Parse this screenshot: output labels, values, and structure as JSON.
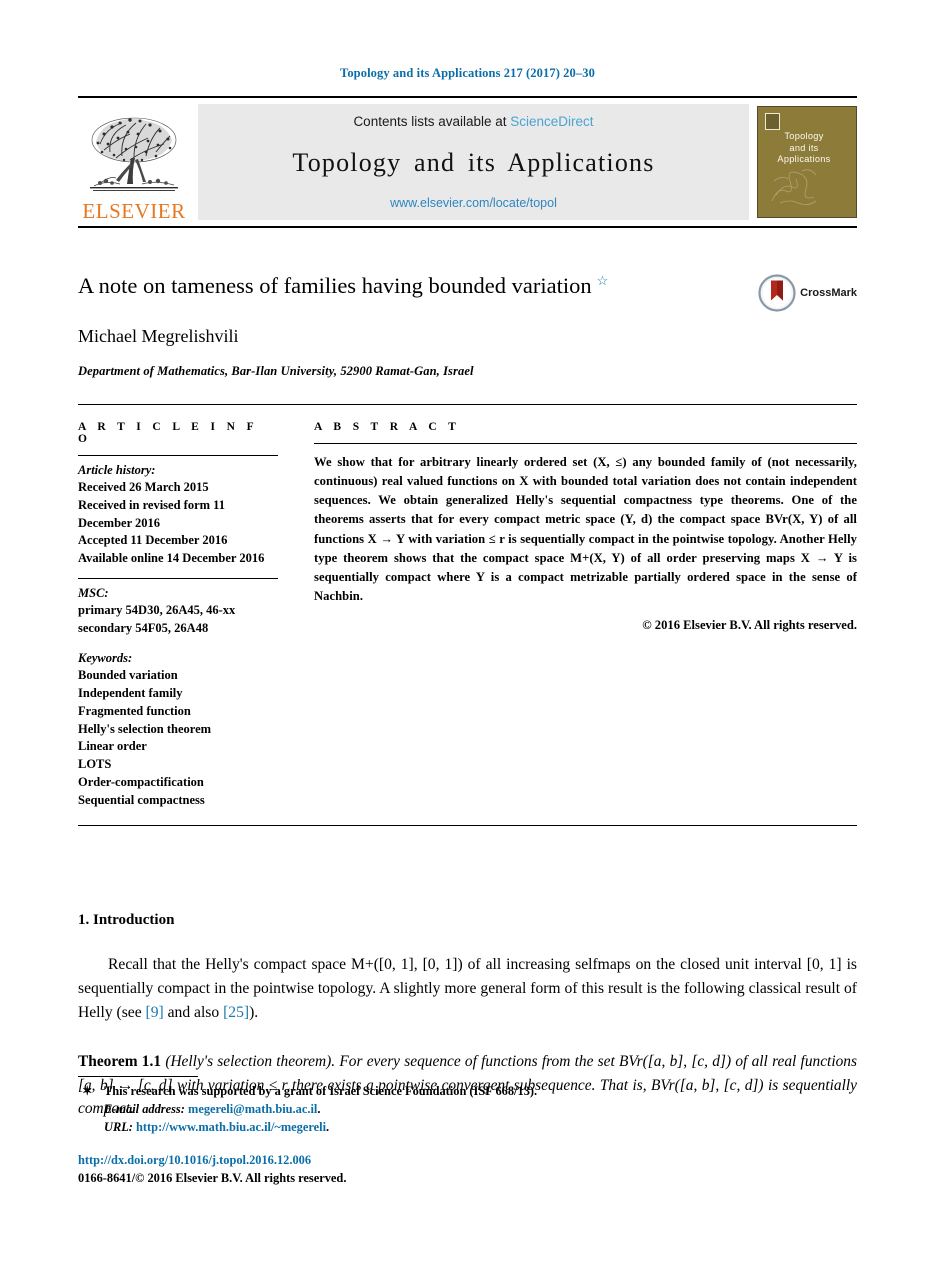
{
  "running_head": "Topology and its Applications 217 (2017) 20–30",
  "masthead": {
    "contents_prefix": "Contents lists available at ",
    "sciencedirect": "ScienceDirect",
    "journal_title": "Topology and its Applications",
    "journal_url": "www.elsevier.com/locate/topol",
    "publisher_wordmark": "ELSEVIER",
    "cover_title": "Topology\nand its\nApplications",
    "accent_link": "#4ba3d3",
    "cover_color": "#8d7b3a"
  },
  "article": {
    "title": "A note on tameness of families having bounded variation",
    "title_footnote_marker": "☆",
    "author": "Michael Megrelishvili",
    "affiliation": "Department of Mathematics, Bar-Ilan University, 52900 Ramat-Gan, Israel",
    "crossmark_label": "CrossMark"
  },
  "info": {
    "section_label": "A R T I C L E   I N F O",
    "history_label": "Article history:",
    "history": [
      "Received 26 March 2015",
      "Received in revised form 11",
      "December 2016",
      "Accepted 11 December 2016",
      "Available online 14 December 2016"
    ],
    "msc_label": "MSC:",
    "msc": [
      "primary 54D30, 26A45, 46-xx",
      "secondary 54F05, 26A48"
    ],
    "keywords_label": "Keywords:",
    "keywords": [
      "Bounded variation",
      "Independent family",
      "Fragmented function",
      "Helly's selection theorem",
      "Linear order",
      "LOTS",
      "Order-compactification",
      "Sequential compactness"
    ]
  },
  "abstract": {
    "section_label": "A B S T R A C T",
    "text": "We show that for arbitrary linearly ordered set (X, ≤) any bounded family of (not necessarily, continuous) real valued functions on X with bounded total variation does not contain independent sequences. We obtain generalized Helly's sequential compactness type theorems. One of the theorems asserts that for every compact metric space (Y, d) the compact space BVr(X, Y) of all functions X → Y with variation ≤ r is sequentially compact in the pointwise topology. Another Helly type theorem shows that the compact space M+(X, Y) of all order preserving maps X → Y is sequentially compact where Y is a compact metrizable partially ordered space in the sense of Nachbin.",
    "copyright": "© 2016 Elsevier B.V. All rights reserved."
  },
  "body": {
    "section_number_title": "1. Introduction",
    "paragraph_1_part1": "Recall that the Helly's compact space M+([0, 1], [0, 1]) of all increasing selfmaps on the closed unit interval [0, 1] is sequentially compact in the pointwise topology. A slightly more general form of this result is the following classical result of Helly (see ",
    "citation_1": "[9]",
    "paragraph_1_part2": " and also ",
    "citation_2": "[25]",
    "paragraph_1_part3": ").",
    "theorem_name": "Theorem 1.1",
    "theorem_text": " (Helly's selection theorem). For every sequence of functions from the set BVr([a, b], [c, d]) of all real functions [a, b] → [c, d] with variation ≤ r there exists a pointwise convergent subsequence. That is, BVr([a, b], [c, d]) is sequentially compact."
  },
  "footnotes": {
    "star_marker": "✶",
    "grant_note": "This research was supported by a grant of Israel Science Foundation (ISF 668/13).",
    "email_label": "E-mail address:",
    "email": "megereli@math.biu.ac.il",
    "url_label": "URL:",
    "url": "http://www.math.biu.ac.il/~megereli",
    "doi": "http://dx.doi.org/10.1016/j.topol.2016.12.006",
    "issn_line": "0166-8641/© 2016 Elsevier B.V. All rights reserved."
  }
}
